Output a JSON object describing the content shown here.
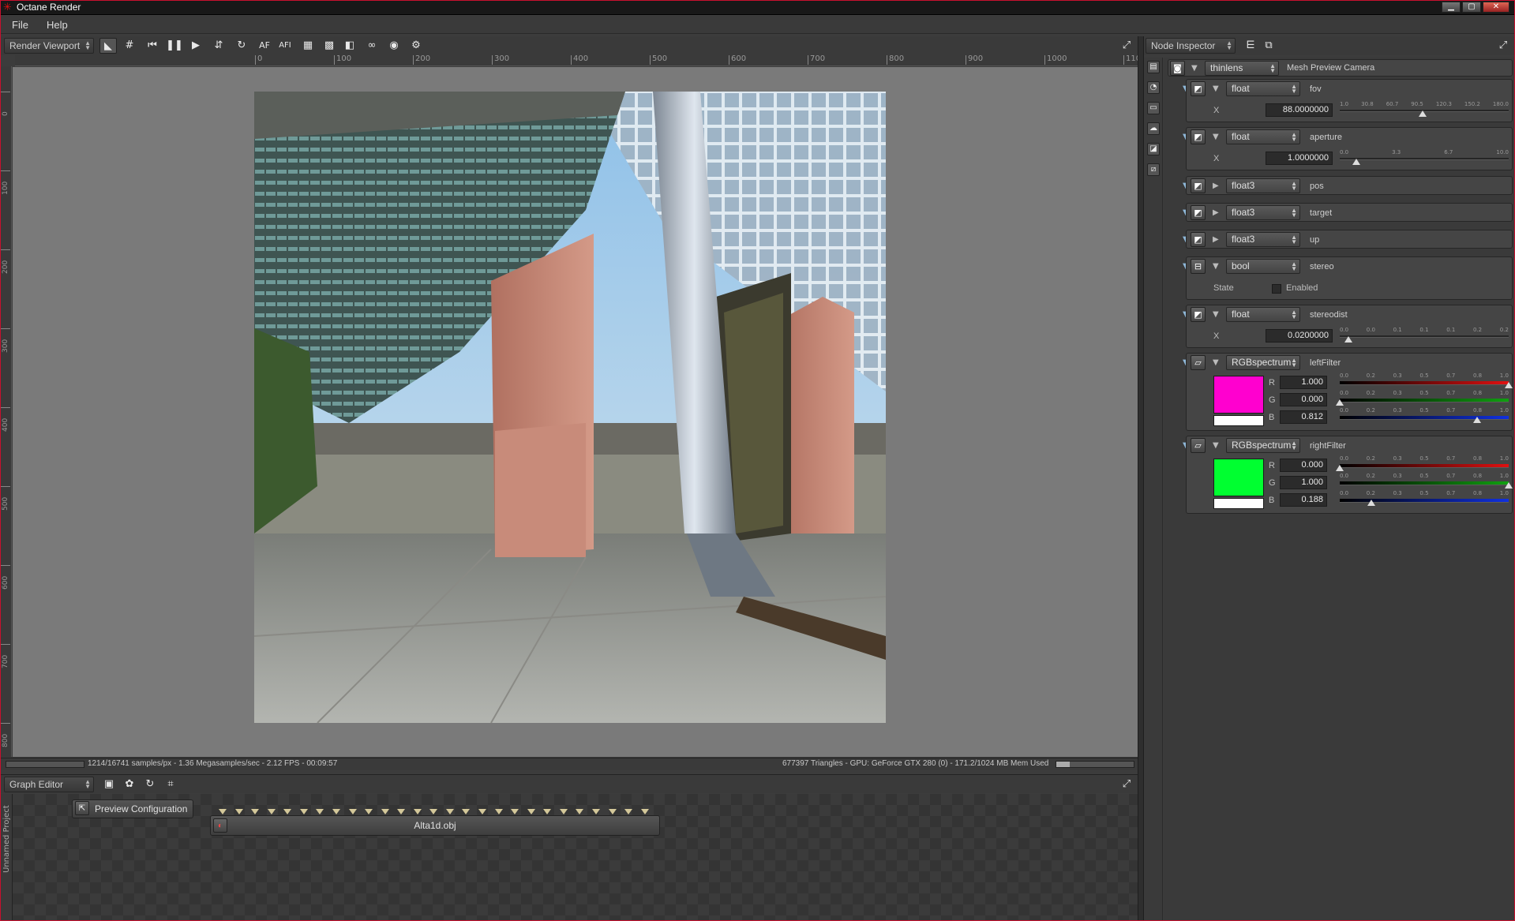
{
  "window": {
    "title": "Octane Render",
    "logo": "octane-logo-icon"
  },
  "menu": {
    "file": "File",
    "help": "Help"
  },
  "viewport_toolbar": {
    "mode_select": "Render Viewport",
    "af_label": "AF",
    "afi_label": "AFI"
  },
  "ruler": {
    "h_ticks": [
      "0",
      "100",
      "200",
      "300",
      "400",
      "500",
      "600",
      "700",
      "800",
      "900",
      "1000",
      "110"
    ],
    "v_ticks": [
      "0",
      "100",
      "200",
      "300",
      "400",
      "500",
      "600",
      "700",
      "800"
    ]
  },
  "status": {
    "samples": "1214/16741 samples/px - 1.36 Megasamples/sec - 2.12 FPS - 00:09:57",
    "gpu": "677397 Triangles - GPU: GeForce GTX 280 (0) - 171.2/1024 MB Mem Used",
    "mem_fraction": 0.17
  },
  "graph_editor": {
    "title": "Graph Editor",
    "side_label": "Unnamed Project",
    "preview_button": "Preview Configuration",
    "obj_node": "Alta1d.obj",
    "pin_count": 27
  },
  "node_inspector": {
    "title": "Node Inspector",
    "node_type": "thinlens",
    "node_name": "Mesh Preview Camera",
    "params": [
      {
        "type": "float",
        "name": "fov",
        "axis": "X",
        "value": "88.0000000",
        "ticks": [
          "1.0",
          "30.8",
          "60.7",
          "90.5",
          "120.3",
          "150.2",
          "180.0"
        ],
        "thumb": 0.49
      },
      {
        "type": "float",
        "name": "aperture",
        "axis": "X",
        "value": "1.0000000",
        "ticks": [
          "0.0",
          "3.3",
          "6.7",
          "10.0"
        ],
        "thumb": 0.1
      },
      {
        "type": "float3",
        "name": "pos"
      },
      {
        "type": "float3",
        "name": "target"
      },
      {
        "type": "float3",
        "name": "up"
      },
      {
        "type": "bool",
        "name": "stereo",
        "state_label": "State",
        "enabled_label": "Enabled"
      },
      {
        "type": "float",
        "name": "stereodist",
        "axis": "X",
        "value": "0.0200000",
        "ticks": [
          "0.0",
          "0.0",
          "0.1",
          "0.1",
          "0.1",
          "0.2",
          "0.2"
        ],
        "thumb": 0.05
      },
      {
        "type": "RGBspectrum",
        "name": "leftFilter",
        "swatch_color": "#ff00cf",
        "channels": [
          {
            "label": "R",
            "value": "1.000",
            "thumb": 1.0,
            "color": "#e01010"
          },
          {
            "label": "G",
            "value": "0.000",
            "thumb": 0.0,
            "color": "#10a010"
          },
          {
            "label": "B",
            "value": "0.812",
            "thumb": 0.812,
            "color": "#1030e0"
          }
        ],
        "ticks": [
          "0.0",
          "0.2",
          "0.3",
          "0.5",
          "0.7",
          "0.8",
          "1.0"
        ]
      },
      {
        "type": "RGBspectrum",
        "name": "rightFilter",
        "swatch_color": "#00ff30",
        "channels": [
          {
            "label": "R",
            "value": "0.000",
            "thumb": 0.0,
            "color": "#e01010"
          },
          {
            "label": "G",
            "value": "1.000",
            "thumb": 1.0,
            "color": "#10a010"
          },
          {
            "label": "B",
            "value": "0.188",
            "thumb": 0.188,
            "color": "#1030e0"
          }
        ],
        "ticks": [
          "0.0",
          "0.2",
          "0.3",
          "0.5",
          "0.7",
          "0.8",
          "1.0"
        ]
      }
    ]
  }
}
